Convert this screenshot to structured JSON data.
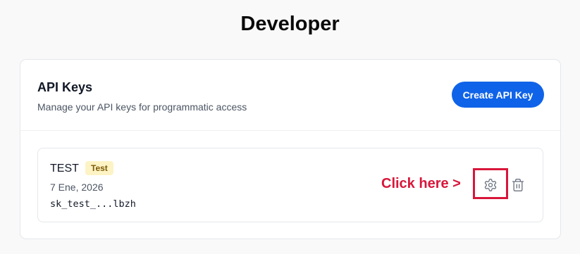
{
  "page": {
    "title": "Developer"
  },
  "api_keys": {
    "title": "API Keys",
    "description": "Manage your API keys for programmatic access",
    "create_button_label": "Create API Key",
    "items": [
      {
        "name": "TEST",
        "badge": "Test",
        "date": "7 Ene, 2026",
        "key_masked": "sk_test_...lbzh",
        "actions": [
          {
            "icon": "gear-icon",
            "purpose": "settings"
          },
          {
            "icon": "trash-icon",
            "purpose": "delete"
          }
        ]
      }
    ]
  },
  "annotation": {
    "text": "Click here >",
    "color": "#d8163a"
  },
  "colors": {
    "primary": "#0f63e8",
    "badge_bg": "#fdf3c4",
    "badge_text": "#7c5a06",
    "annotation": "#d8163a"
  }
}
